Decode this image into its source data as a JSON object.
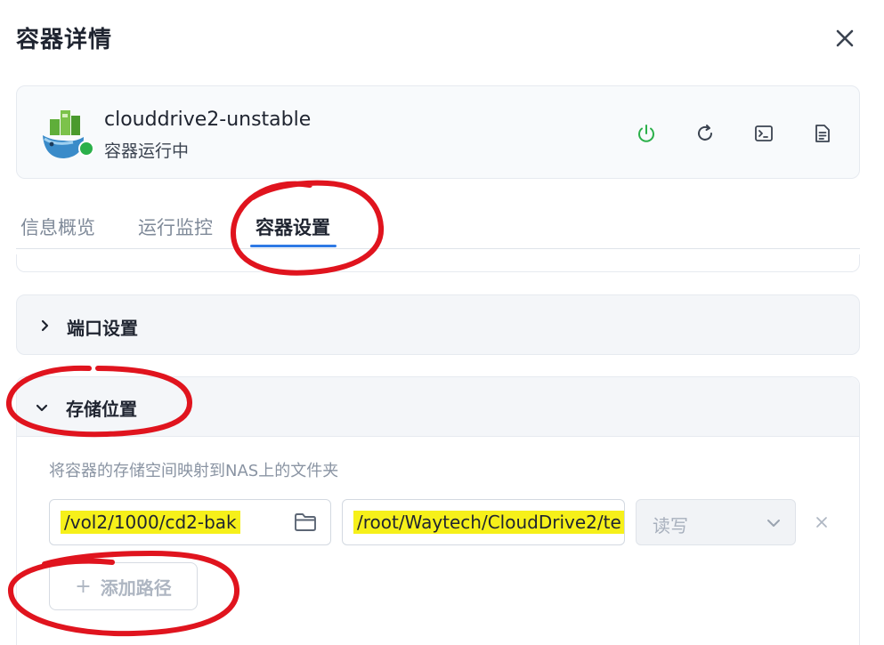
{
  "dialog": {
    "title": "容器详情"
  },
  "container": {
    "name": "clouddrive2-unstable",
    "status": "容器运行中",
    "status_color": "#2bb04a",
    "actions": [
      {
        "name": "power-icon",
        "color": "#2bb04a"
      },
      {
        "name": "restart-icon"
      },
      {
        "name": "terminal-icon"
      },
      {
        "name": "log-icon"
      }
    ]
  },
  "tabs": [
    {
      "label": "信息概览",
      "active": false
    },
    {
      "label": "运行监控",
      "active": false
    },
    {
      "label": "容器设置",
      "active": true
    }
  ],
  "sections": {
    "ports": {
      "label": "端口设置",
      "expanded": false
    },
    "storage": {
      "label": "存储位置",
      "expanded": true,
      "description": "将容器的存储空间映射到NAS上的文件夹",
      "mappings": [
        {
          "host_path": "/vol2/1000/cd2-bak",
          "container_path": "/root/Waytech/CloudDrive2/te",
          "mode": "读写"
        }
      ],
      "add_label": "添加路径"
    }
  },
  "colors": {
    "accent": "#2f7ae5",
    "highlight": "#f6f01a",
    "annotation": "#e0141e"
  }
}
